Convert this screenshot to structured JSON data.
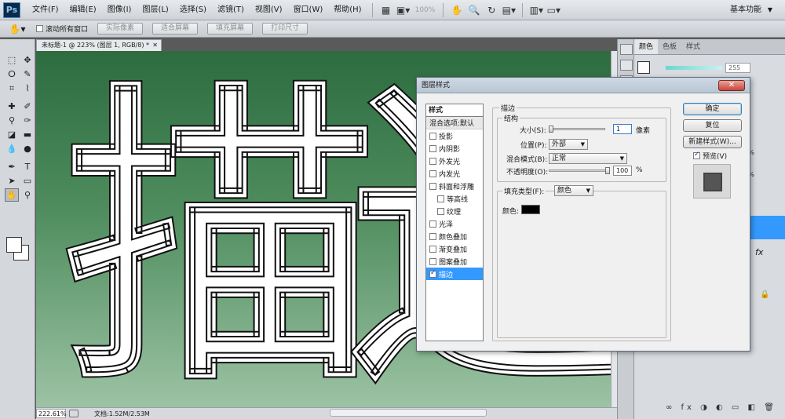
{
  "app": {
    "logo": "Ps",
    "menu": [
      "文件(F)",
      "编辑(E)",
      "图像(I)",
      "图层(L)",
      "选择(S)",
      "滤镜(T)",
      "视图(V)",
      "窗口(W)",
      "帮助(H)"
    ],
    "zoom_display": "100%",
    "workspace": "基本功能"
  },
  "options_bar": {
    "scroll_all_label": "滚动所有窗口",
    "scroll_all_checked": false,
    "buttons": [
      "实际像素",
      "适合屏幕",
      "填充屏幕",
      "打印尺寸"
    ]
  },
  "document": {
    "tab_title": "未标题-1 @ 223% (图层 1, RGB/8) *",
    "canvas_text_1": "描",
    "canvas_text_2": "边"
  },
  "status": {
    "zoom": "222.61%",
    "doc_info": "文档:1.52M/2.53M"
  },
  "panels": {
    "tabs": [
      "颜色",
      "色板",
      "样式"
    ],
    "color_value": "255",
    "opacity_1": "100%",
    "opacity_2": "100%"
  },
  "dialog": {
    "title": "图层样式",
    "styles_header": "样式",
    "style_items": [
      {
        "label": "混合选项:默认",
        "checkbox": false,
        "kind": "blend"
      },
      {
        "label": "投影",
        "checkbox": true,
        "checked": false
      },
      {
        "label": "内阴影",
        "checkbox": true,
        "checked": false
      },
      {
        "label": "外发光",
        "checkbox": true,
        "checked": false
      },
      {
        "label": "内发光",
        "checkbox": true,
        "checked": false
      },
      {
        "label": "斜面和浮雕",
        "checkbox": true,
        "checked": false
      },
      {
        "label": "等高线",
        "checkbox": true,
        "checked": false,
        "indent": true
      },
      {
        "label": "纹理",
        "checkbox": true,
        "checked": false,
        "indent": true
      },
      {
        "label": "光泽",
        "checkbox": true,
        "checked": false
      },
      {
        "label": "颜色叠加",
        "checkbox": true,
        "checked": false
      },
      {
        "label": "渐变叠加",
        "checkbox": true,
        "checked": false
      },
      {
        "label": "图案叠加",
        "checkbox": true,
        "checked": false
      },
      {
        "label": "描边",
        "checkbox": true,
        "checked": true,
        "selected": true
      }
    ],
    "stroke_legend": "描边",
    "structure_legend": "结构",
    "size_label": "大小(S):",
    "size_value": "1",
    "size_unit": "像素",
    "position_label": "位置(P):",
    "position_value": "外部",
    "blend_label": "混合模式(B):",
    "blend_value": "正常",
    "opacity_label": "不透明度(O):",
    "opacity_value": "100",
    "opacity_unit": "%",
    "opacity_fraction": 1.0,
    "size_fraction": 0.0,
    "fill_type_label": "填充类型(F):",
    "fill_type_value": "颜色",
    "color_label": "颜色:",
    "stroke_color": "#000000",
    "buttons": {
      "ok": "确定",
      "reset": "复位",
      "new_style": "新建样式(W)...",
      "preview": "预览(V)"
    },
    "preview_checked": true
  }
}
